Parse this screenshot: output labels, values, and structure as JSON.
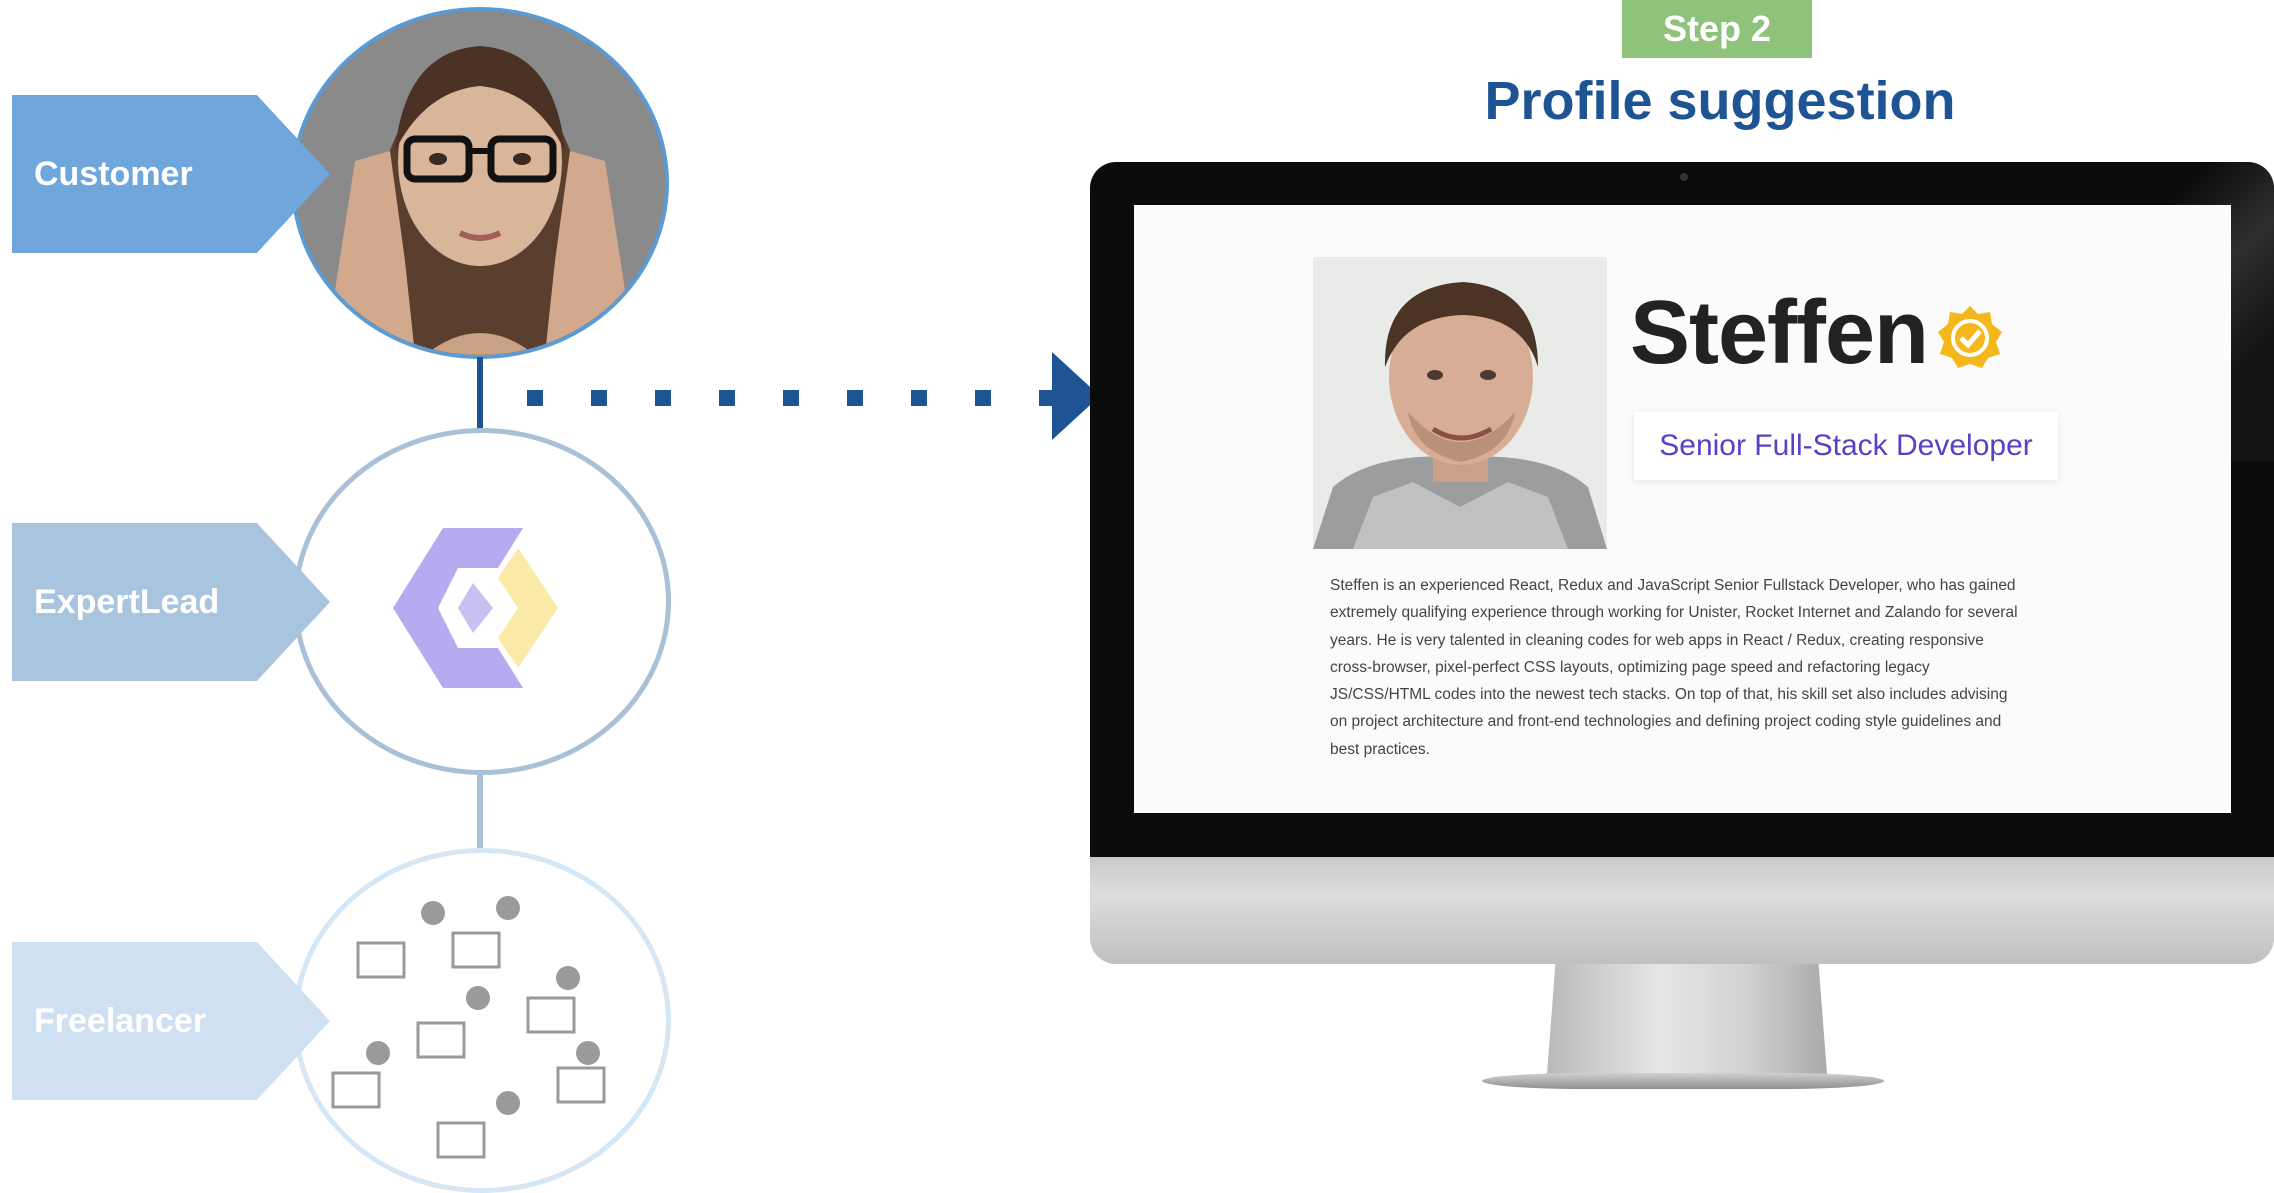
{
  "roles": {
    "customer": "Customer",
    "expertlead": "ExpertLead",
    "freelancer": "Freelancer"
  },
  "step": {
    "badge": "Step 2",
    "title": "Profile suggestion"
  },
  "profile": {
    "name": "Steffen",
    "role": "Senior Full-Stack Developer",
    "bio": "Steffen is an experienced React, Redux and JavaScript Senior Fullstack Developer, who has gained extremely qualifying experience through working for Unister, Rocket Internet and Zalando for several years. He is very talented in cleaning codes for web apps in React / Redux, creating responsive cross-browser, pixel-perfect CSS layouts, optimizing page speed and refactoring legacy JS/CSS/HTML codes into the newest tech stacks. On top of that, his skill set also includes advising on project architecture and front-end technologies and defining project coding style guidelines and best practices.",
    "verified_icon": "verified-badge-icon"
  },
  "colors": {
    "navy": "#1f5494",
    "customer_tag": "#6fa6db",
    "expertlead_tag": "#a9c4df",
    "freelancer_tag": "#cfe0f2",
    "step_badge": "#8fc27a",
    "role_text": "#5b3fc7"
  }
}
